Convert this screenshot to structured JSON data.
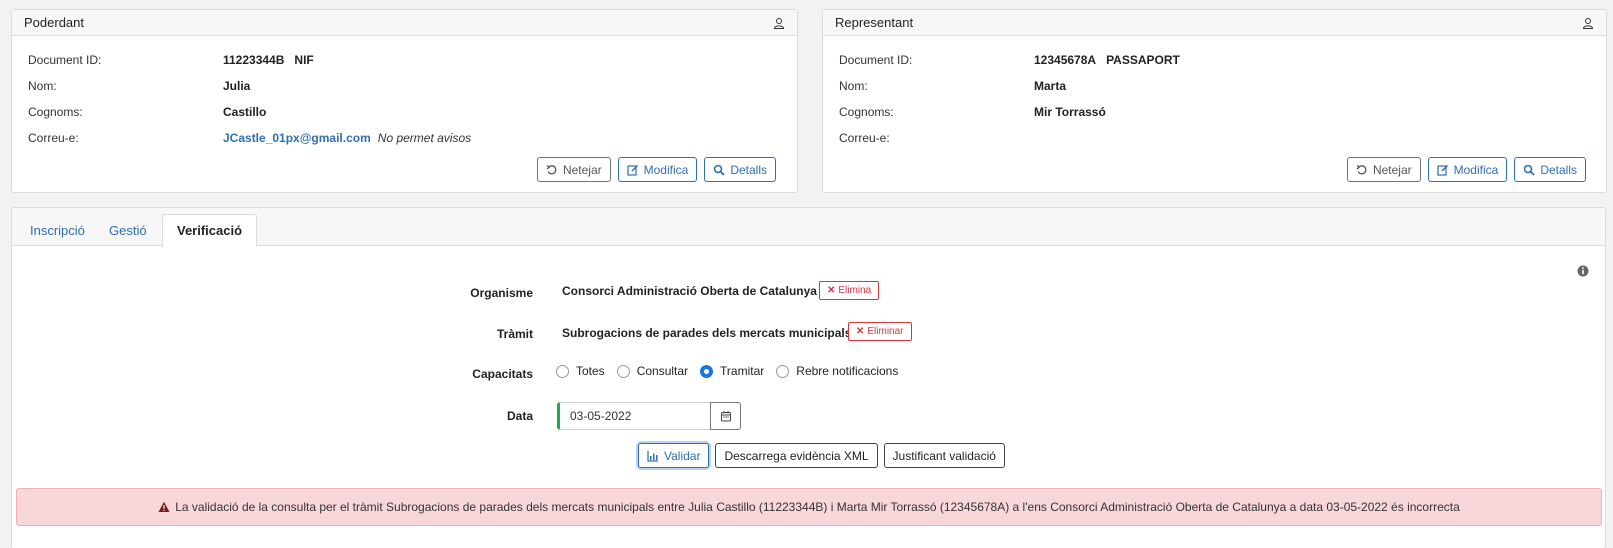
{
  "poderdant": {
    "title": "Poderdant",
    "labels": {
      "doc": "Document ID:",
      "nom": "Nom:",
      "cognoms": "Cognoms:",
      "correu": "Correu-e:"
    },
    "doc_id": "11223344B",
    "doc_type": "NIF",
    "nom": "Julia",
    "cognoms": "Castillo",
    "email": "JCastle_01px@gmail.com",
    "email_note": "No permet avisos"
  },
  "representant": {
    "title": "Representant",
    "labels": {
      "doc": "Document ID:",
      "nom": "Nom:",
      "cognoms": "Cognoms:",
      "correu": "Correu-e:"
    },
    "doc_id": "12345678A",
    "doc_type": "PASSAPORT",
    "nom": "Marta",
    "cognoms": "Mir Torrassó",
    "email": ""
  },
  "card_buttons": {
    "clear": "Netejar",
    "edit": "Modifica",
    "details": "Detalls"
  },
  "tabs": [
    {
      "label": "Inscripció",
      "active": false
    },
    {
      "label": "Gestió",
      "active": false
    },
    {
      "label": "Verificació",
      "active": true
    }
  ],
  "form": {
    "organisme_label": "Organisme",
    "organisme_value": "Consorci Administració Oberta de Catalunya",
    "organisme_remove": "Elimina",
    "tramit_label": "Tràmit",
    "tramit_value": "Subrogacions de parades dels mercats municipals",
    "tramit_remove": "Eliminar",
    "capacitats_label": "Capacitats",
    "capacitats_options": [
      "Totes",
      "Consultar",
      "Tramitar",
      "Rebre notificacions"
    ],
    "capacitats_selected": "Tramitar",
    "data_label": "Data",
    "data_value": "03-05-2022"
  },
  "actions": {
    "validate": "Validar",
    "download": "Descarrega evidència XML",
    "proof": "Justificant validació"
  },
  "alert": {
    "text": "La validació de la consulta per el tràmit Subrogacions de parades dels mercats municipals entre Julia Castillo (11223344B) i Marta Mir Torrassó (12345678A) a l'ens Consorci Administració Oberta de Catalunya a data 03-05-2022 és incorrecta"
  },
  "colors": {
    "accent": "#2f6fb4",
    "danger": "#d9363e",
    "alert_bg": "#f8d7da",
    "success": "#28a745"
  },
  "icons": [
    "user-icon",
    "undo-icon",
    "edit-icon",
    "search-icon",
    "info-icon",
    "close-icon",
    "calendar-icon",
    "chart-icon",
    "warning-icon"
  ]
}
